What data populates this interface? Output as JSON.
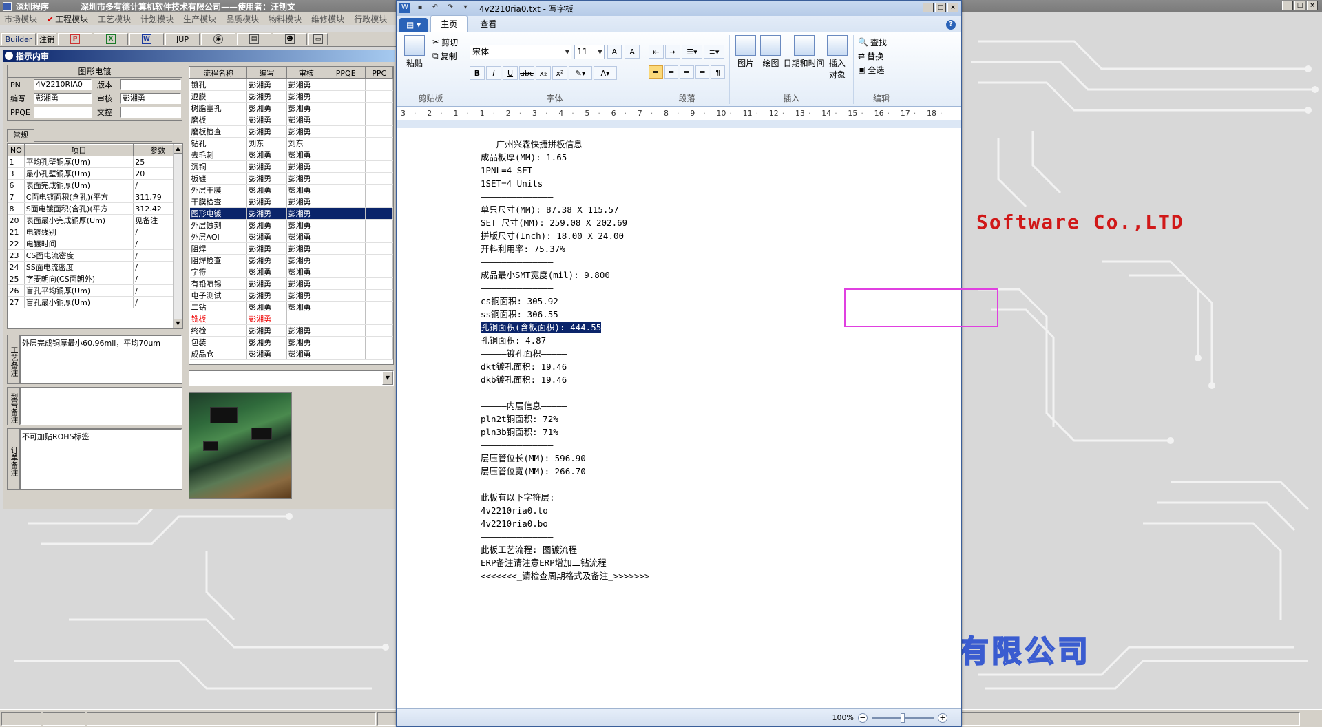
{
  "app": {
    "title_short": "深圳程序",
    "title_long": "深圳市多有德计算机软件技术有限公司——使用者：汪刨文",
    "minimize": "_",
    "maximize": "□",
    "close": "×"
  },
  "module_menu": [
    {
      "label": "市场模块",
      "checked": false
    },
    {
      "label": "工程模块",
      "checked": true
    },
    {
      "label": "工艺模块",
      "checked": false
    },
    {
      "label": "计划模块",
      "checked": false
    },
    {
      "label": "生产模块",
      "checked": false
    },
    {
      "label": "品质模块",
      "checked": false
    },
    {
      "label": "物料模块",
      "checked": false
    },
    {
      "label": "维修模块",
      "checked": false
    },
    {
      "label": "行政模块",
      "checked": false
    }
  ],
  "toolbar": {
    "builder": "Builder",
    "cancel": "注销",
    "jup": "JUP"
  },
  "panel_title": "指示内审",
  "info_box": {
    "title": "图形电镀",
    "pn_label": "PN",
    "pn_value": "4V2210RIA0",
    "version_label": "版本",
    "version_value": "",
    "author_label": "编写",
    "author_value": "彭湘勇",
    "reviewer_label": "审核",
    "reviewer_value": "彭湘勇",
    "ppqe_label": "PPQE",
    "ppqe_value": "",
    "doc_label": "文控",
    "doc_value": ""
  },
  "params_tab": "常规",
  "params_table": {
    "headers": [
      "NO",
      "项目",
      "参数"
    ],
    "rows": [
      [
        "1",
        "平均孔壁铜厚(Um)",
        "25"
      ],
      [
        "3",
        "最小孔壁铜厚(Um)",
        "20"
      ],
      [
        "6",
        "表面完成铜厚(Um)",
        "/"
      ],
      [
        "7",
        "C面电镀面积(含孔)(平方",
        "311.79"
      ],
      [
        "8",
        "S面电镀面积(含孔)(平方",
        "312.42"
      ],
      [
        "20",
        "表面最小完成铜厚(Um)",
        "见备注"
      ],
      [
        "21",
        "电镀线别",
        "/"
      ],
      [
        "22",
        "电镀时间",
        "/"
      ],
      [
        "23",
        "CS面电流密度",
        "/"
      ],
      [
        "24",
        "SS面电流密度",
        "/"
      ],
      [
        "25",
        "字麦朝向(CS面朝外)",
        "/"
      ],
      [
        "26",
        "盲孔平均铜厚(Um)",
        "/"
      ],
      [
        "27",
        "盲孔最小铜厚(Um)",
        "/"
      ]
    ]
  },
  "notes": [
    {
      "label": "工艺备注",
      "text": "外层完成铜厚最小60.96mil，平均70um"
    },
    {
      "label": "型号备注",
      "text": ""
    },
    {
      "label": "订单备注",
      "text": "不可加贴ROHS标签"
    }
  ],
  "process_table": {
    "headers": [
      "流程名称",
      "编写",
      "审核",
      "PPQE",
      "PPC"
    ],
    "rows": [
      [
        "镀孔",
        "彭湘勇",
        "彭湘勇"
      ],
      [
        "退膜",
        "彭湘勇",
        "彭湘勇"
      ],
      [
        "树脂塞孔",
        "彭湘勇",
        "彭湘勇"
      ],
      [
        "磨板",
        "彭湘勇",
        "彭湘勇"
      ],
      [
        "磨板检查",
        "彭湘勇",
        "彭湘勇"
      ],
      [
        "钻孔",
        "刘东",
        "刘东"
      ],
      [
        "去毛刺",
        "彭湘勇",
        "彭湘勇"
      ],
      [
        "沉铜",
        "彭湘勇",
        "彭湘勇"
      ],
      [
        "板镀",
        "彭湘勇",
        "彭湘勇"
      ],
      [
        "外层干膜",
        "彭湘勇",
        "彭湘勇"
      ],
      [
        "干膜检查",
        "彭湘勇",
        "彭湘勇"
      ],
      [
        "图形电镀",
        "彭湘勇",
        "彭湘勇"
      ],
      [
        "外层蚀刻",
        "彭湘勇",
        "彭湘勇"
      ],
      [
        "外层AOI",
        "彭湘勇",
        "彭湘勇"
      ],
      [
        "阻焊",
        "彭湘勇",
        "彭湘勇"
      ],
      [
        "阻焊检查",
        "彭湘勇",
        "彭湘勇"
      ],
      [
        "字符",
        "彭湘勇",
        "彭湘勇"
      ],
      [
        "有铅喷锡",
        "彭湘勇",
        "彭湘勇"
      ],
      [
        "电子测试",
        "彭湘勇",
        "彭湘勇"
      ],
      [
        "二钻",
        "彭湘勇",
        "彭湘勇"
      ],
      [
        "铣板",
        "彭湘勇",
        ""
      ],
      [
        "终检",
        "彭湘勇",
        "彭湘勇"
      ],
      [
        "包装",
        "彭湘勇",
        "彭湘勇"
      ],
      [
        "成品仓",
        "彭湘勇",
        "彭湘勇"
      ]
    ],
    "selected_index": 11,
    "red_index": 20
  },
  "desktop": {
    "software_text": "Software Co.,LTD",
    "company_text": "有限公司"
  },
  "wordpad": {
    "title": "4v2210ria0.txt - 写字板",
    "tabs": [
      "主页",
      "查看"
    ],
    "clipboard": {
      "paste": "粘贴",
      "cut": "剪切",
      "copy": "复制",
      "label": "剪贴板"
    },
    "font": {
      "name": "宋体",
      "size": "11",
      "label": "字体"
    },
    "paragraph_label": "段落",
    "insert": {
      "picture": "图片",
      "paint": "绘图",
      "datetime": "日期和时间",
      "object": "插入对象",
      "label": "插入"
    },
    "edit": {
      "find": "查找",
      "replace": "替换",
      "select_all": "全选",
      "label": "编辑"
    },
    "ruler_numbers": [
      "3",
      "2",
      "1",
      "1",
      "2",
      "3",
      "4",
      "5",
      "6",
      "7",
      "8",
      "9",
      "10",
      "11",
      "12",
      "13",
      "14",
      "15",
      "16",
      "17",
      "18"
    ],
    "zoom": "100%",
    "document_lines": [
      "———广州兴森快捷拼板信息——",
      "成品板厚(MM): 1.65",
      "1PNL=4 SET",
      "1SET=4 Units",
      "——————————————",
      "单只尺寸(MM): 87.38 X 115.57",
      "SET 尺寸(MM): 259.08 X 202.69",
      "拼版尺寸(Inch): 18.00 X 24.00",
      "开料利用率: 75.37%",
      "——————————————",
      "成品最小SMT宽度(mil): 9.800",
      "——————————————",
      "cs铜面积: 305.92",
      "ss铜面积: 306.55",
      "孔铜面积(含板面积): 444.55",
      "孔铜面积: 4.87",
      "—————镀孔面积—————",
      "dkt镀孔面积: 19.46",
      "dkb镀孔面积: 19.46",
      "",
      "—————内层信息—————",
      "pln2t铜面积: 72%",
      "pln3b铜面积: 71%",
      "——————————————",
      "层压管位长(MM): 596.90",
      "层压管位宽(MM): 266.70",
      "——————————————",
      "此板有以下字符层:",
      "4v2210ria0.to",
      "4v2210ria0.bo",
      "——————————————",
      "此板工艺流程: 图镀流程",
      "ERP备注请注意ERP增加二钻流程",
      "<<<<<<<_请检查周期格式及备注_>>>>>>>"
    ],
    "highlight_line": 14
  }
}
